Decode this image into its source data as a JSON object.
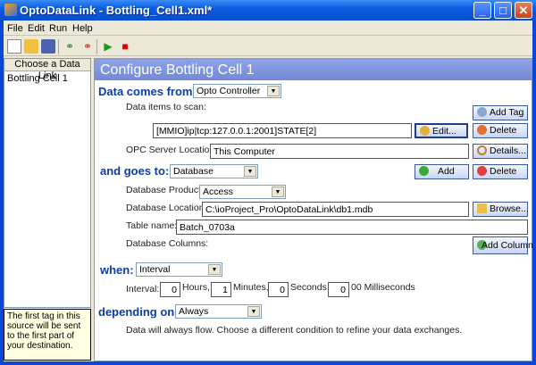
{
  "window": {
    "title": "OptoDataLink - Bottling_Cell1.xml*",
    "controls": [
      "minimize",
      "maximize",
      "close"
    ]
  },
  "menu": [
    "File",
    "Edit",
    "Run",
    "Help"
  ],
  "toolbar": [
    "new-icon",
    "open-icon",
    "save-icon",
    "add-link-icon",
    "delete-link-icon",
    "run-icon",
    "stop-icon"
  ],
  "sidebar": {
    "header": "Choose a Data Link",
    "items": [
      "Bottling Cell 1"
    ],
    "tip": "The first tag in this source will be sent to the first part of your destination."
  },
  "main": {
    "title": "Configure Bottling Cell 1",
    "source": {
      "label": "Data comes from:",
      "value": "Opto Controller",
      "items_label": "Data items to scan:",
      "tag": "[MMIO]ip|tcp:127.0.0.1:2001]STATE[2]",
      "add_tag": "Add Tag",
      "edit": "Edit...",
      "delete": "Delete",
      "opc_label": "OPC Server Location:",
      "opc_value": "This Computer",
      "details": "Details..."
    },
    "dest": {
      "label": "and goes to:",
      "value": "Database",
      "add": "Add",
      "delete": "Delete",
      "product_label": "Database Product:",
      "product": "Access",
      "location_label": "Database Location:",
      "location": "C:\\ioProject_Pro\\OptoDataLink\\db1.mdb",
      "browse": "Browse...",
      "table_label": "Table name:",
      "table": "Batch_0703a",
      "columns_label": "Database Columns:",
      "add_column": "Add Column"
    },
    "when": {
      "label": "when:",
      "value": "Interval",
      "interval_label": "Interval:",
      "hours": "0",
      "hours_label": "Hours,",
      "minutes": "1",
      "minutes_label": "Minutes,",
      "seconds": "0",
      "seconds_label": "Seconds,",
      "ms": "0",
      "ms_label": "00 Milliseconds"
    },
    "depending": {
      "label": "depending on:",
      "value": "Always",
      "description": "Data will always flow. Choose a different condition to refine your data exchanges."
    }
  }
}
